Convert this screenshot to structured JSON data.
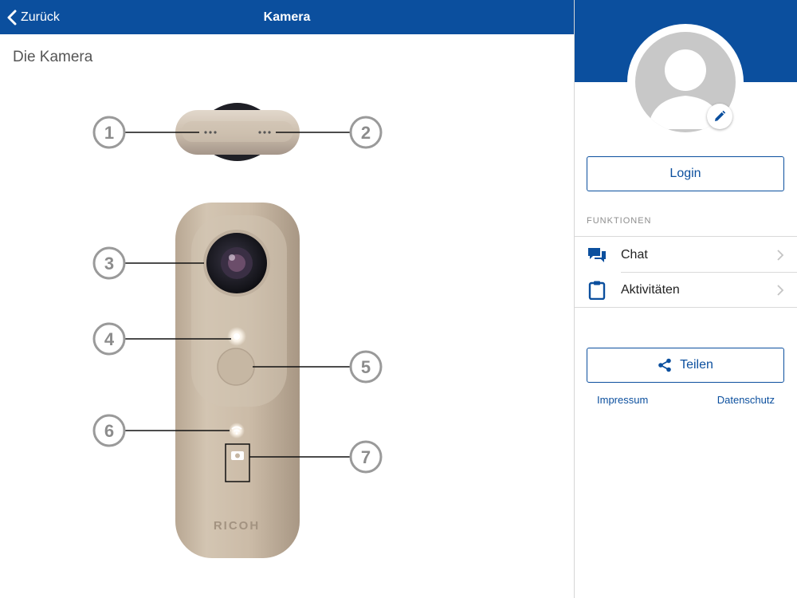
{
  "navbar": {
    "back_label": "Zurück",
    "title": "Kamera"
  },
  "content": {
    "section_title": "Die Kamera",
    "callouts": [
      "1",
      "2",
      "3",
      "4",
      "5",
      "6",
      "7"
    ],
    "camera_brand": "RICOH"
  },
  "sidebar": {
    "login_label": "Login",
    "functions_header": "FUNKTIONEN",
    "menu": [
      {
        "label": "Chat",
        "icon": "chat-icon"
      },
      {
        "label": "Aktivitäten",
        "icon": "clipboard-icon"
      }
    ],
    "share_label": "Teilen",
    "links": {
      "imprint": "Impressum",
      "privacy": "Datenschutz"
    }
  },
  "colors": {
    "brand_blue": "#0b4f9e",
    "avatar_gray": "#c8c8c8",
    "camera_beige": "#c9b9a5"
  }
}
